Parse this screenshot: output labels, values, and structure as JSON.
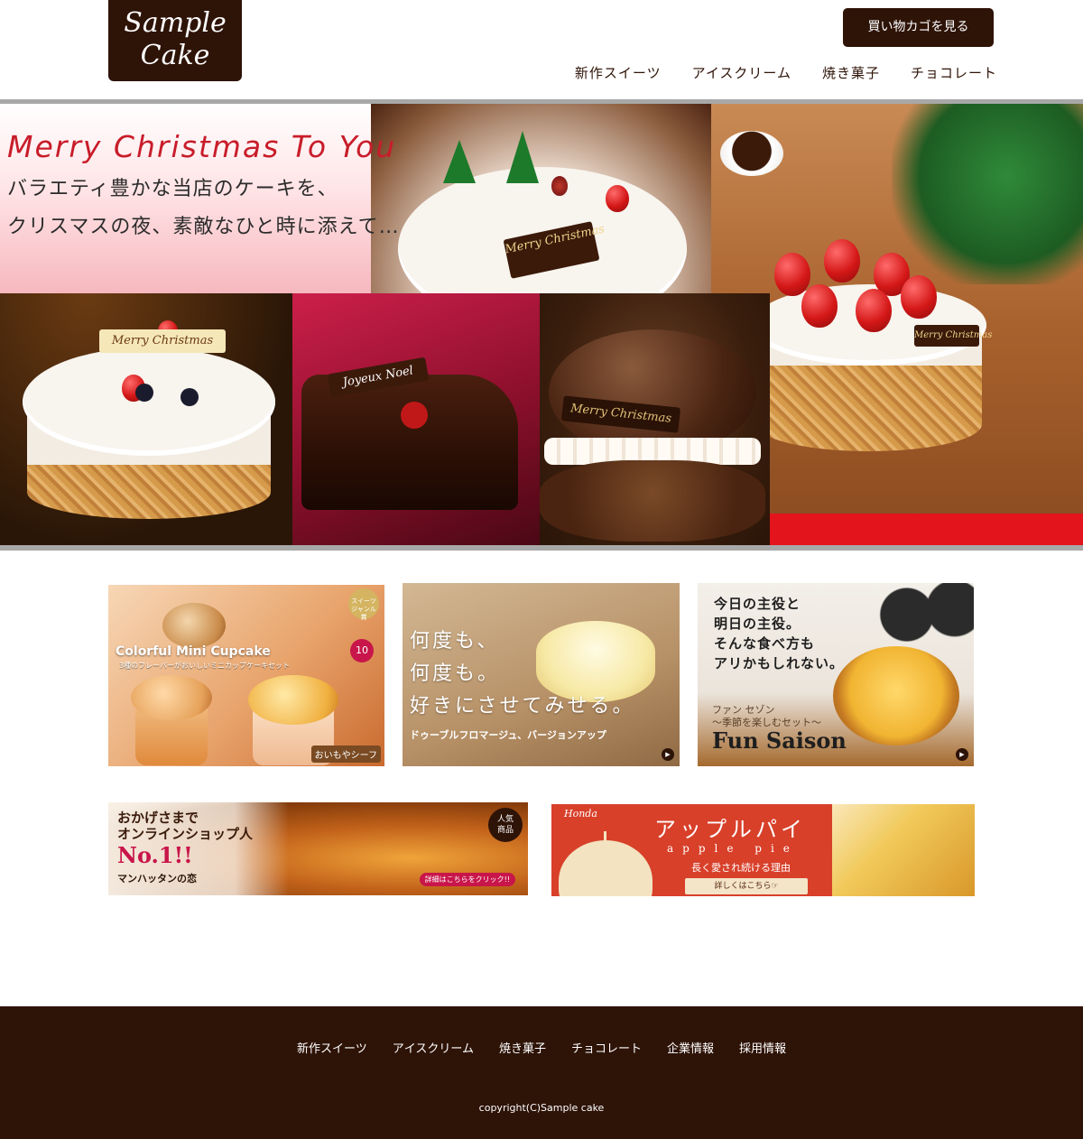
{
  "header": {
    "logo": {
      "line1": "Sample",
      "line2": "Cake"
    },
    "cart_button": "買い物カゴを見る",
    "nav": [
      "新作スイーツ",
      "アイスクリーム",
      "焼き菓子",
      "チョコレート"
    ]
  },
  "hero": {
    "title": "Merry Christmas To You",
    "subtitle_line1": "バラエティ豊かな当店のケーキを、",
    "subtitle_line2": "クリスマスの夜、素敵なひと時に添えて…",
    "plaques": [
      "Merry Christmas",
      "Merry Christmas",
      "Joyeux Noel",
      "Merry Christmas",
      "Merry Christmas"
    ]
  },
  "banners": {
    "cupcake": {
      "title": "Colorful Mini Cupcake",
      "sub": "3種のフレーバーがおいしいミニカップケーキセット",
      "seal1": "スイーツジャンル賞",
      "seal2": "10",
      "corner": "おいもやシーフ"
    },
    "fromage": {
      "line1": "何度も、",
      "line2": "何度も。",
      "line3": "好きにさせてみせる。",
      "caption": "ドゥーブルフロマージュ、バージョンアップ"
    },
    "saison": {
      "line1": "今日の主役と",
      "line2": "明日の主役。",
      "line3": "そんな食べ方も",
      "line4": "アリかもしれない。",
      "small1": "ファン セゾン",
      "small2": "〜季節を楽しむセット〜",
      "big": "Fun Saison"
    },
    "manhattan": {
      "line1": "おかげさまで",
      "line2": "オンラインショップ人",
      "no1": "No.1!!",
      "name": "マンハッタンの恋",
      "badge_line1": "人気",
      "badge_line2": "商品",
      "link": "詳細はこちらをクリック!!"
    },
    "applepie": {
      "brand": "Honda",
      "title": "アップルパイ",
      "en": "apple pie",
      "why": "長く愛され続ける理由",
      "button": "詳しくはこちら☞"
    }
  },
  "footer": {
    "nav": [
      "新作スイーツ",
      "アイスクリーム",
      "焼き菓子",
      "チョコレート",
      "企業情報",
      "採用情報"
    ],
    "copyright": "copyright(C)Sample cake"
  },
  "colors": {
    "brand_brown": "#2e1307",
    "hero_title_red": "#c81d2a",
    "hero_border_gray": "#a8a8a8"
  }
}
